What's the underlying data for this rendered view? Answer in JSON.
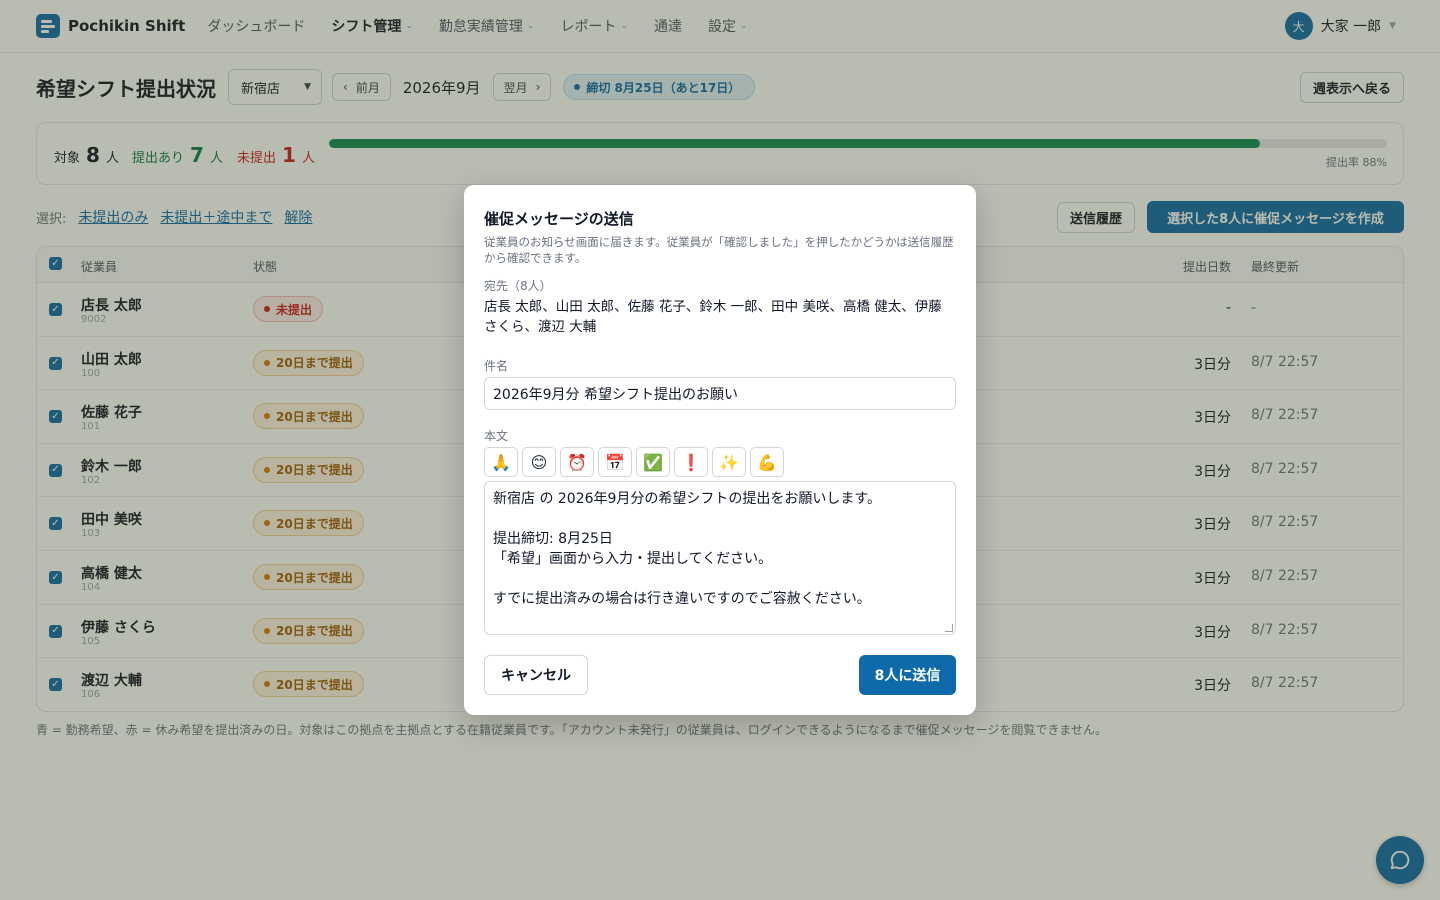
{
  "app": {
    "brand": "Pochikin Shift",
    "nav": [
      {
        "label": "ダッシュボード",
        "has_menu": false
      },
      {
        "label": "シフト管理",
        "has_menu": true
      },
      {
        "label": "勤怠実績管理",
        "has_menu": true
      },
      {
        "label": "レポート",
        "has_menu": true
      },
      {
        "label": "通達",
        "has_menu": false
      },
      {
        "label": "設定",
        "has_menu": true
      }
    ],
    "user": {
      "initial": "大",
      "name": "大家 一郎"
    }
  },
  "page": {
    "title": "希望シフト提出状況",
    "store": "新宿店",
    "prev_label": "前月",
    "month": "2026年9月",
    "next_label": "翌月",
    "deadline": "締切 8月25日（あと17日）",
    "back_label": "週表示へ戻る"
  },
  "summary": {
    "total_label": "対象",
    "total": "8",
    "total_unit": "人",
    "submitted_label": "提出あり",
    "submitted": "7",
    "submitted_unit": "人",
    "unsubmitted_label": "未提出",
    "unsubmitted": "1",
    "unsubmitted_unit": "人",
    "rate_text": "提出率 88%",
    "rate": 0.88
  },
  "selection": {
    "label": "選択:",
    "links": [
      "未提出のみ",
      "未提出＋途中まで",
      "解除"
    ],
    "history_label": "送信履歴",
    "compose_label": "選択した8人に催促メッセージを作成"
  },
  "table": {
    "headers": {
      "employee": "従業員",
      "status": "状態",
      "days": "提出日数",
      "updated": "最終更新"
    },
    "rows": [
      {
        "name": "店長 太郎",
        "code": "9002",
        "status": "未提出",
        "status_type": "unsub",
        "days": "-",
        "updated": "-"
      },
      {
        "name": "山田 太郎",
        "code": "100",
        "status": "20日まで提出",
        "status_type": "partial",
        "days": "3日分",
        "updated": "8/7 22:57"
      },
      {
        "name": "佐藤 花子",
        "code": "101",
        "status": "20日まで提出",
        "status_type": "partial",
        "days": "3日分",
        "updated": "8/7 22:57"
      },
      {
        "name": "鈴木 一郎",
        "code": "102",
        "status": "20日まで提出",
        "status_type": "partial",
        "days": "3日分",
        "updated": "8/7 22:57"
      },
      {
        "name": "田中 美咲",
        "code": "103",
        "status": "20日まで提出",
        "status_type": "partial",
        "days": "3日分",
        "updated": "8/7 22:57"
      },
      {
        "name": "高橋 健太",
        "code": "104",
        "status": "20日まで提出",
        "status_type": "partial",
        "days": "3日分",
        "updated": "8/7 22:57"
      },
      {
        "name": "伊藤 さくら",
        "code": "105",
        "status": "20日まで提出",
        "status_type": "partial",
        "days": "3日分",
        "updated": "8/7 22:57"
      },
      {
        "name": "渡辺 大輔",
        "code": "106",
        "status": "20日まで提出",
        "status_type": "partial",
        "days": "3日分",
        "updated": "8/7 22:57"
      }
    ]
  },
  "footnote": "青 = 勤務希望、赤 = 休み希望を提出済みの日。対象はこの拠点を主拠点とする在籍従業員です。「アカウント未発行」の従業員は、ログインできるようになるまで催促メッセージを閲覧できません。",
  "modal": {
    "title": "催促メッセージの送信",
    "description": "従業員のお知らせ画面に届きます。従業員が「確認しました」を押したかどうかは送信履歴から確認できます。",
    "recipients_label": "宛先（8人）",
    "recipients": "店長 太郎、山田 太郎、佐藤 花子、鈴木 一郎、田中 美咲、高橋 健太、伊藤 さくら、渡辺 大輔",
    "subject_label": "件名",
    "subject": "2026年9月分 希望シフト提出のお願い",
    "body_label": "本文",
    "emojis": [
      "🙏",
      "😊",
      "⏰",
      "📅",
      "✅",
      "❗",
      "✨",
      "💪"
    ],
    "body_lines": [
      "新宿店 の 2026年9月分の希望シフトの提出をお願いします。",
      "",
      "提出締切: 8月25日",
      "「希望」画面から入力・提出してください。",
      "",
      "すでに提出済みの場合は行き違いですのでご容赦ください。"
    ],
    "cancel_label": "キャンセル",
    "send_label": "8人に送信"
  },
  "colors": {
    "primary": "#0e6aa8",
    "success": "#0b8a57",
    "danger": "#c81e1e",
    "warning": "#a15c07"
  }
}
